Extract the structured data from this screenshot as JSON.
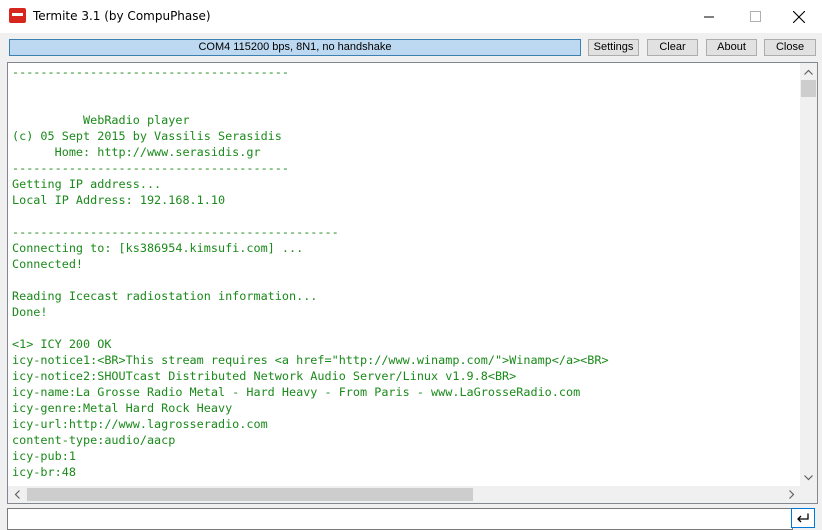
{
  "window": {
    "title": "Termite 3.1 (by CompuPhase)",
    "icon": "termite-app-icon"
  },
  "toolbar": {
    "status": "COM4 115200 bps, 8N1, no handshake",
    "settings_label": "Settings",
    "clear_label": "Clear",
    "about_label": "About",
    "close_label": "Close"
  },
  "terminal": {
    "text_color": "#1a8a1a",
    "lines": [
      "---------------------------------------",
      "",
      "",
      "          WebRadio player",
      "(c) 05 Sept 2015 by Vassilis Serasidis",
      "      Home: http://www.serasidis.gr",
      "---------------------------------------",
      "Getting IP address...",
      "Local IP Address: 192.168.1.10",
      "",
      "----------------------------------------------",
      "Connecting to: [ks386954.kimsufi.com] ...",
      "Connected!",
      "",
      "Reading Icecast radiostation information...",
      "Done!",
      "",
      "<1> ICY 200 OK",
      "icy-notice1:<BR>This stream requires <a href=\"http://www.winamp.com/\">Winamp</a><BR>",
      "icy-notice2:SHOUTcast Distributed Network Audio Server/Linux v1.9.8<BR>",
      "icy-name:La Grosse Radio Metal - Hard Heavy - From Paris - www.LaGrosseRadio.com",
      "icy-genre:Metal Hard Rock Heavy",
      "icy-url:http://www.lagrosseradio.com",
      "content-type:audio/aacp",
      "icy-pub:1",
      "icy-br:48"
    ]
  },
  "input": {
    "value": ""
  }
}
